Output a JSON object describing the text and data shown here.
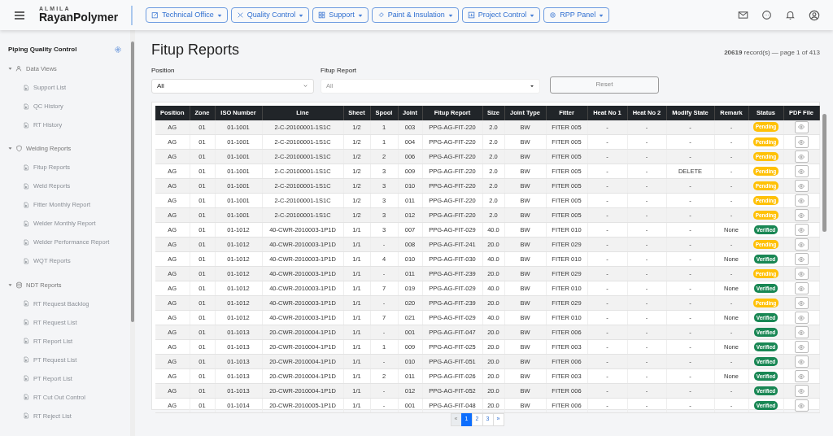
{
  "brand": {
    "company": "ALMILA",
    "name_bold": "Rayan",
    "name_rest": "Polymer"
  },
  "menus": [
    {
      "label": "Technical Office"
    },
    {
      "label": "Quality Control"
    },
    {
      "label": "Support"
    },
    {
      "label": "Paint & Insulation"
    },
    {
      "label": "Project Control"
    },
    {
      "label": "RPP Panel"
    }
  ],
  "sidebar": {
    "title": "Piping Quality Control",
    "groups": [
      {
        "label": "Data Views",
        "expanded": true,
        "children": [
          {
            "label": "Support List"
          },
          {
            "label": "QC History"
          },
          {
            "label": "RT History"
          }
        ]
      },
      {
        "label": "Welding Reports",
        "expanded": true,
        "children": [
          {
            "label": "Fitup Reports"
          },
          {
            "label": "Weld Reports"
          },
          {
            "label": "Fitter Monthly Report"
          },
          {
            "label": "Welder Monthly Report"
          },
          {
            "label": "Welder Performance Report"
          },
          {
            "label": "WQT Reports"
          }
        ]
      },
      {
        "label": "NDT Reports",
        "expanded": true,
        "children": [
          {
            "label": "RT Request Backlog"
          },
          {
            "label": "RT Request List"
          },
          {
            "label": "RT Report List"
          },
          {
            "label": "PT Request List"
          },
          {
            "label": "PT Report List"
          },
          {
            "label": "RT Cut Out Control"
          },
          {
            "label": "RT Reject List"
          }
        ]
      }
    ]
  },
  "page": {
    "title": "Fitup Reports",
    "summary": "**20619** record(s) — page 1 of 413"
  },
  "filters": [
    {
      "label": "Position",
      "value": "All",
      "disabled": false
    },
    {
      "label": "Fitup Report",
      "value": "All",
      "disabled": true
    }
  ],
  "reset_button": {
    "label": "Reset"
  },
  "table": {
    "columns": [
      "Position",
      "Zone",
      "ISO Number",
      "Line",
      "Sheet",
      "Spool",
      "Joint",
      "Fitup Report",
      "Size",
      "Joint Type",
      "Fitter",
      "Heat No 1",
      "Heat No 2",
      "Modify State",
      "Remark",
      "Status",
      "PDF File"
    ],
    "rows": [
      {
        "cells": [
          "AG",
          "01",
          "01-1001",
          "2-C-20100001-1S1C",
          "1/2",
          "1",
          "003",
          "PPG-AG-FIT-220",
          "2.0",
          "BW",
          "FITER 005",
          "-",
          "-",
          "-",
          "-"
        ],
        "status": {
          "label": "Pending",
          "color": "#ffc107"
        }
      },
      {
        "cells": [
          "AG",
          "01",
          "01-1001",
          "2-C-20100001-1S1C",
          "1/2",
          "1",
          "004",
          "PPG-AG-FIT-220",
          "2.0",
          "BW",
          "FITER 005",
          "-",
          "-",
          "-",
          "-"
        ],
        "status": {
          "label": "Pending",
          "color": "#ffc107"
        }
      },
      {
        "cells": [
          "AG",
          "01",
          "01-1001",
          "2-C-20100001-1S1C",
          "1/2",
          "2",
          "006",
          "PPG-AG-FIT-220",
          "2.0",
          "BW",
          "FITER 005",
          "-",
          "-",
          "-",
          "-"
        ],
        "status": {
          "label": "Pending",
          "color": "#ffc107"
        }
      },
      {
        "cells": [
          "AG",
          "01",
          "01-1001",
          "2-C-20100001-1S1C",
          "1/2",
          "3",
          "009",
          "PPG-AG-FIT-220",
          "2.0",
          "BW",
          "FITER 005",
          "-",
          "-",
          "DELETE",
          "-"
        ],
        "status": {
          "label": "Pending",
          "color": "#ffc107"
        }
      },
      {
        "cells": [
          "AG",
          "01",
          "01-1001",
          "2-C-20100001-1S1C",
          "1/2",
          "3",
          "010",
          "PPG-AG-FIT-220",
          "2.0",
          "BW",
          "FITER 005",
          "-",
          "-",
          "-",
          "-"
        ],
        "status": {
          "label": "Pending",
          "color": "#ffc107"
        }
      },
      {
        "cells": [
          "AG",
          "01",
          "01-1001",
          "2-C-20100001-1S1C",
          "1/2",
          "3",
          "011",
          "PPG-AG-FIT-220",
          "2.0",
          "BW",
          "FITER 005",
          "-",
          "-",
          "-",
          "-"
        ],
        "status": {
          "label": "Pending",
          "color": "#ffc107"
        }
      },
      {
        "cells": [
          "AG",
          "01",
          "01-1001",
          "2-C-20100001-1S1C",
          "1/2",
          "3",
          "012",
          "PPG-AG-FIT-220",
          "2.0",
          "BW",
          "FITER 005",
          "-",
          "-",
          "-",
          "-"
        ],
        "status": {
          "label": "Pending",
          "color": "#ffc107"
        }
      },
      {
        "cells": [
          "AG",
          "01",
          "01-1012",
          "40-CWR-2010003-1P1D",
          "1/1",
          "3",
          "007",
          "PPG-AG-FIT-029",
          "40.0",
          "BW",
          "FITER 010",
          "-",
          "-",
          "-",
          "None"
        ],
        "status": {
          "label": "Verified",
          "color": "#198754"
        }
      },
      {
        "cells": [
          "AG",
          "01",
          "01-1012",
          "40-CWR-2010003-1P1D",
          "1/1",
          "-",
          "008",
          "PPG-AG-FIT-241",
          "20.0",
          "BW",
          "FITER 029",
          "-",
          "-",
          "-",
          "-"
        ],
        "status": {
          "label": "Pending",
          "color": "#ffc107"
        }
      },
      {
        "cells": [
          "AG",
          "01",
          "01-1012",
          "40-CWR-2010003-1P1D",
          "1/1",
          "4",
          "010",
          "PPG-AG-FIT-030",
          "40.0",
          "BW",
          "FITER 010",
          "-",
          "-",
          "-",
          "None"
        ],
        "status": {
          "label": "Verified",
          "color": "#198754"
        }
      },
      {
        "cells": [
          "AG",
          "01",
          "01-1012",
          "40-CWR-2010003-1P1D",
          "1/1",
          "-",
          "011",
          "PPG-AG-FIT-239",
          "20.0",
          "BW",
          "FITER 029",
          "-",
          "-",
          "-",
          "-"
        ],
        "status": {
          "label": "Pending",
          "color": "#ffc107"
        }
      },
      {
        "cells": [
          "AG",
          "01",
          "01-1012",
          "40-CWR-2010003-1P1D",
          "1/1",
          "7",
          "019",
          "PPG-AG-FIT-029",
          "40.0",
          "BW",
          "FITER 010",
          "-",
          "-",
          "-",
          "None"
        ],
        "status": {
          "label": "Verified",
          "color": "#198754"
        }
      },
      {
        "cells": [
          "AG",
          "01",
          "01-1012",
          "40-CWR-2010003-1P1D",
          "1/1",
          "-",
          "020",
          "PPG-AG-FIT-239",
          "20.0",
          "BW",
          "FITER 029",
          "-",
          "-",
          "-",
          "-"
        ],
        "status": {
          "label": "Pending",
          "color": "#ffc107"
        }
      },
      {
        "cells": [
          "AG",
          "01",
          "01-1012",
          "40-CWR-2010003-1P1D",
          "1/1",
          "7",
          "021",
          "PPG-AG-FIT-029",
          "40.0",
          "BW",
          "FITER 010",
          "-",
          "-",
          "-",
          "None"
        ],
        "status": {
          "label": "Verified",
          "color": "#198754"
        }
      },
      {
        "cells": [
          "AG",
          "01",
          "01-1013",
          "20-CWR-2010004-1P1D",
          "1/1",
          "-",
          "001",
          "PPG-AG-FIT-047",
          "20.0",
          "BW",
          "FITER 006",
          "-",
          "-",
          "-",
          "-"
        ],
        "status": {
          "label": "Verified",
          "color": "#198754"
        }
      },
      {
        "cells": [
          "AG",
          "01",
          "01-1013",
          "20-CWR-2010004-1P1D",
          "1/1",
          "1",
          "009",
          "PPG-AG-FIT-025",
          "20.0",
          "BW",
          "FITER 003",
          "-",
          "-",
          "-",
          "None"
        ],
        "status": {
          "label": "Verified",
          "color": "#198754"
        }
      },
      {
        "cells": [
          "AG",
          "01",
          "01-1013",
          "20-CWR-2010004-1P1D",
          "1/1",
          "-",
          "010",
          "PPG-AG-FIT-051",
          "20.0",
          "BW",
          "FITER 006",
          "-",
          "-",
          "-",
          "-"
        ],
        "status": {
          "label": "Verified",
          "color": "#198754"
        }
      },
      {
        "cells": [
          "AG",
          "01",
          "01-1013",
          "20-CWR-2010004-1P1D",
          "1/1",
          "2",
          "011",
          "PPG-AG-FIT-026",
          "20.0",
          "BW",
          "FITER 003",
          "-",
          "-",
          "-",
          "None"
        ],
        "status": {
          "label": "Verified",
          "color": "#198754"
        }
      },
      {
        "cells": [
          "AG",
          "01",
          "01-1013",
          "20-CWR-2010004-1P1D",
          "1/1",
          "-",
          "012",
          "PPG-AG-FIT-052",
          "20.0",
          "BW",
          "FITER 006",
          "-",
          "-",
          "-",
          "-"
        ],
        "status": {
          "label": "Verified",
          "color": "#198754"
        }
      },
      {
        "cells": [
          "AG",
          "01",
          "01-1014",
          "20-CWR-2010005-1P1D",
          "1/1",
          "-",
          "001",
          "PPG-AG-FIT-048",
          "20.0",
          "BW",
          "FITER 006",
          "-",
          "-",
          "-",
          "-"
        ],
        "status": {
          "label": "Verified",
          "color": "#198754"
        }
      }
    ]
  },
  "pagination": [
    {
      "label": "«",
      "selected": false
    },
    {
      "label": "1",
      "selected": true
    },
    {
      "label": "2",
      "selected": false
    },
    {
      "label": "3",
      "selected": false
    },
    {
      "label": "»",
      "selected": false
    }
  ]
}
